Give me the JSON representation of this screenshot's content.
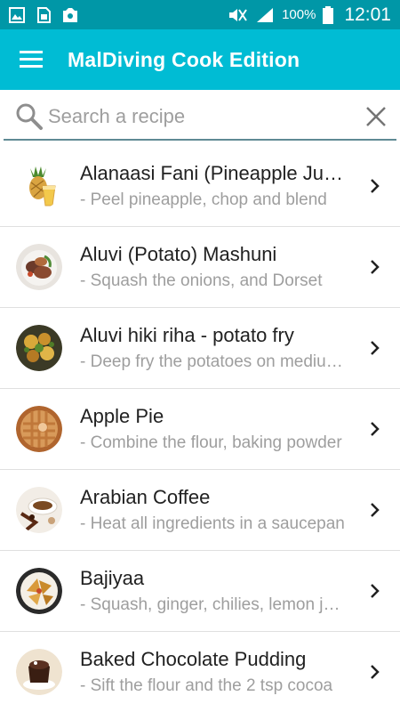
{
  "status_bar": {
    "icons": [
      "image-icon",
      "sim-card-icon",
      "photo-sync-icon"
    ],
    "battery_text": "100%",
    "clock": "12:01",
    "color": "#0097a7"
  },
  "app_bar": {
    "title": "MalDiving Cook Edition",
    "color": "#00bcd4",
    "menu_icon": "hamburger-menu-icon"
  },
  "search": {
    "placeholder": "Search a recipe",
    "value": "",
    "search_icon": "search-icon",
    "clear_icon": "close-icon"
  },
  "recipes": [
    {
      "title": "Alanaasi Fani (Pineapple Juice)",
      "desc": "- Peel pineapple, chop and blend",
      "thumb": "pineapple-juice"
    },
    {
      "title": "Aluvi (Potato) Mashuni",
      "desc": "- Squash the onions, and Dorset",
      "thumb": "potato-mashuni"
    },
    {
      "title": "Aluvi hiki riha - potato fry",
      "desc": "- Deep fry the potatoes on medium heat",
      "thumb": "potato-fry"
    },
    {
      "title": "Apple Pie",
      "desc": "- Combine the flour, baking powder",
      "thumb": "apple-pie"
    },
    {
      "title": "Arabian Coffee",
      "desc": "- Heat all ingredients in a saucepan",
      "thumb": "arabian-coffee"
    },
    {
      "title": "Bajiyaa",
      "desc": "- Squash, ginger, chilies, lemon juice",
      "thumb": "bajiyaa"
    },
    {
      "title": "Baked Chocolate Pudding",
      "desc": "- Sift the flour and the 2 tsp cocoa",
      "thumb": "chocolate-pudding"
    }
  ]
}
